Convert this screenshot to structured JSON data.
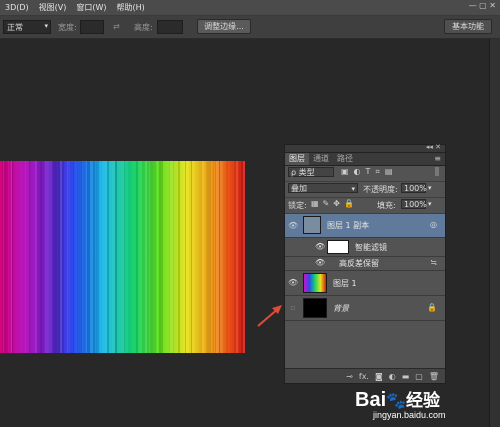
{
  "menubar": {
    "items": [
      "3D(D)",
      "视图(V)",
      "窗口(W)",
      "帮助(H)"
    ],
    "window_controls": "— ▢ ✕"
  },
  "options": {
    "mode": "正常",
    "width_label": "宽度:",
    "height_label": "高度:",
    "refine_button": "调整边缘...",
    "workspace": "基本功能"
  },
  "panel": {
    "tabs": [
      "图层",
      "通道",
      "路径"
    ],
    "filter_type": "ρ 类型",
    "blend_mode": "叠加",
    "opacity_label": "不透明度:",
    "opacity_value": "100%",
    "lock_label": "锁定:",
    "fill_label": "填充:",
    "fill_value": "100%",
    "layers": [
      {
        "name": "图层 1 副本",
        "selected": true
      },
      {
        "name": "智能滤镜"
      },
      {
        "name": "高反差保留"
      },
      {
        "name": "图层 1"
      },
      {
        "name": "背景"
      }
    ],
    "footer_icons": [
      "link-icon",
      "fx-icon",
      "mask-icon",
      "adjustment-icon",
      "group-icon",
      "new-layer-icon",
      "trash-icon"
    ],
    "footer_fx": "fx."
  },
  "watermark": {
    "brand": "Bai",
    "paw": "🐾",
    "brand2": "经验",
    "url": "jingyan.baidu.com"
  },
  "colors": {
    "accent_arrow": "#e04a3a",
    "selected_layer": "#5f7a9a"
  }
}
